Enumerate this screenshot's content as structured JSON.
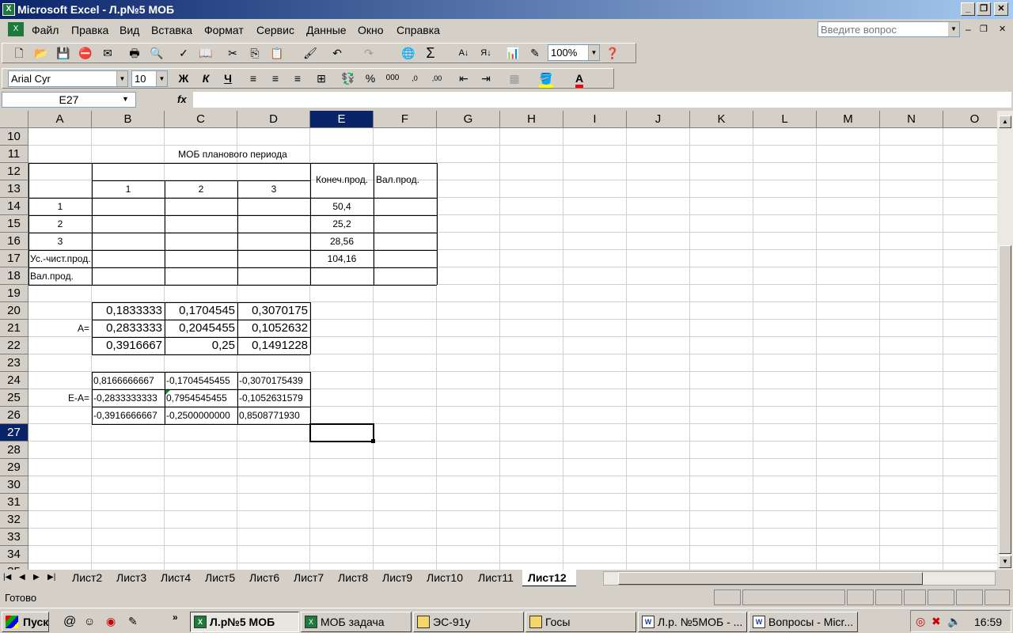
{
  "window": {
    "title": "Microsoft Excel - Л.р№5 МОБ",
    "app_icon": "excel-icon"
  },
  "menu": [
    "Файл",
    "Правка",
    "Вид",
    "Вставка",
    "Формат",
    "Сервис",
    "Данные",
    "Окно",
    "Справка"
  ],
  "help_box": {
    "placeholder": "Введите вопрос"
  },
  "toolbar": {
    "zoom": "100%"
  },
  "format_bar": {
    "font": "Arial Cyr",
    "size": "10",
    "bold": "Ж",
    "italic": "К",
    "underline": "Ч"
  },
  "formula_bar": {
    "name_box": "E27",
    "fx": "fx",
    "value": ""
  },
  "columns": [
    "A",
    "B",
    "C",
    "D",
    "E",
    "F",
    "G",
    "H",
    "I",
    "J",
    "K",
    "L",
    "M",
    "N",
    "O"
  ],
  "rows": [
    "10",
    "11",
    "12",
    "13",
    "14",
    "15",
    "16",
    "17",
    "18",
    "19",
    "20",
    "21",
    "22",
    "23",
    "24",
    "25",
    "26",
    "27",
    "28",
    "29",
    "30",
    "31",
    "32",
    "33",
    "34",
    "35"
  ],
  "active_cell": "E27",
  "cells": {
    "title": "МОБ планового периода",
    "h1": "1",
    "h2": "2",
    "h3": "3",
    "final_prod": "Конеч.прод.",
    "gross_prod": "Вал.прод.",
    "r14a": "1",
    "r15a": "2",
    "r16a": "3",
    "e14": "50,4",
    "e15": "25,2",
    "e16": "28,56",
    "e17": "104,16",
    "a17": "Ус.-чист.прод.",
    "a18": "Вал.прод.",
    "a21": "A=",
    "b20": "0,1833333",
    "c20": "0,1704545",
    "d20": "0,3070175",
    "b21": "0,2833333",
    "c21": "0,2045455",
    "d21": "0,1052632",
    "b22": "0,3916667",
    "c22": "0,25",
    "d22": "0,1491228",
    "a25": "E-A=",
    "b24": "0,8166666667",
    "c24": "-0,1704545455",
    "d24": "-0,3070175439",
    "b25": "-0,2833333333",
    "c25": "0,7954545455",
    "d25": "-0,1052631579",
    "b26": "-0,3916666667",
    "c26": "-0,2500000000",
    "d26": "0,8508771930"
  },
  "sheets": [
    "Лист2",
    "Лист3",
    "Лист4",
    "Лист5",
    "Лист6",
    "Лист7",
    "Лист8",
    "Лист9",
    "Лист10",
    "Лист11",
    "Лист12"
  ],
  "active_sheet": "Лист12",
  "status": "Готово",
  "taskbar": {
    "start": "Пуск",
    "tasks": [
      "Л.р№5 МОБ",
      "МОБ задача",
      "ЭС-91у",
      "Госы",
      "Л.р. №5МОБ - ...",
      "Вопросы - Micr..."
    ],
    "clock": "16:59"
  }
}
